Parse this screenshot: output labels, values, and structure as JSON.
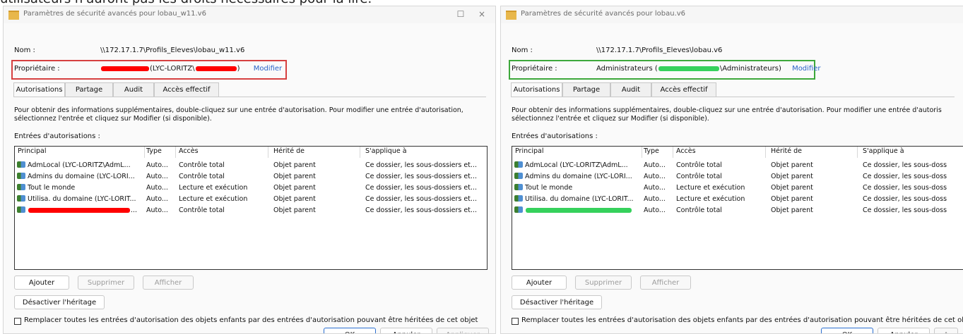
{
  "top_text": "utilisateurs n'auront pas les droits nécessaires pour la lire.",
  "windows": [
    {
      "side": "left",
      "title": "Paramètres de sécurité avancés pour lobau_w11.v6",
      "controls": {
        "maximize": "☐",
        "close": "×"
      },
      "name_label": "Nom :",
      "name_value": "\\\\172.17.1.7\\Profils_Eleves\\lobau_w11.v6",
      "owner_label": "Propriétaire :",
      "owner_value_parts": [
        "(LYC-LORITZ\\",
        ")"
      ],
      "owner_link": "Modifier",
      "tabs": [
        "Autorisations",
        "Partage",
        "Audit",
        "Accès effectif"
      ],
      "active_tab": 0,
      "info": "Pour obtenir des informations supplémentaires, double-cliquez sur une entrée d'autorisation. Pour modifier une entrée d'autorisation, sélectionnez l'entrée et cliquez sur Modifier (si disponible).",
      "entries_label": "Entrées d'autorisations :",
      "columns": [
        "Principal",
        "Type",
        "Accès",
        "Hérité de",
        "S'applique à"
      ],
      "rows": [
        [
          "AdmLocal (LYC-LORITZ\\AdmL...",
          "Auto...",
          "Contrôle total",
          "Objet parent",
          "Ce dossier, les sous-dossiers et..."
        ],
        [
          "Admins du domaine (LYC-LORI...",
          "Auto...",
          "Contrôle total",
          "Objet parent",
          "Ce dossier, les sous-dossiers et..."
        ],
        [
          "Tout le monde",
          "Auto...",
          "Lecture et exécution",
          "Objet parent",
          "Ce dossier, les sous-dossiers et..."
        ],
        [
          "Utilisa. du domaine (LYC-LORIT...",
          "Auto...",
          "Lecture et exécution",
          "Objet parent",
          "Ce dossier, les sous-dossiers et..."
        ],
        [
          "...",
          "Auto...",
          "Contrôle total",
          "Objet parent",
          "Ce dossier, les sous-dossiers et..."
        ]
      ],
      "buttons": {
        "add": "Ajouter",
        "remove": "Supprimer",
        "view": "Afficher",
        "disable_inheritance": "Désactiver l'héritage"
      },
      "checkbox_label": "Remplacer toutes les entrées d'autorisation des objets enfants par des entrées d'autorisation pouvant être héritées de cet objet",
      "footer": {
        "ok": "OK",
        "cancel": "Annuler",
        "apply": "Appliquer"
      },
      "colors": {
        "owner_box": "#d64040",
        "redaction": "#ff0000"
      }
    },
    {
      "side": "right",
      "title": "Paramètres de sécurité avancés pour lobau.v6",
      "name_label": "Nom :",
      "name_value": "\\\\172.17.1.7\\Profils_Eleves\\lobau.v6",
      "owner_label": "Propriétaire :",
      "owner_value_parts": [
        "Administrateurs (",
        "\\Administrateurs)"
      ],
      "owner_link": "Modifier",
      "tabs": [
        "Autorisations",
        "Partage",
        "Audit",
        "Accès effectif"
      ],
      "active_tab": 0,
      "info": "Pour obtenir des informations supplémentaires, double-cliquez sur une entrée d'autorisation. Pour modifier une entrée d'autoris sélectionnez l'entrée et cliquez sur Modifier (si disponible).",
      "entries_label": "Entrées d'autorisations :",
      "columns": [
        "Principal",
        "Type",
        "Accès",
        "Hérité de",
        "S'applique à"
      ],
      "rows": [
        [
          "AdmLocal (LYC-LORITZ\\AdmL...",
          "Auto...",
          "Contrôle total",
          "Objet parent",
          "Ce dossier, les sous-doss"
        ],
        [
          "Admins du domaine (LYC-LORI...",
          "Auto...",
          "Contrôle total",
          "Objet parent",
          "Ce dossier, les sous-doss"
        ],
        [
          "Tout le monde",
          "Auto...",
          "Lecture et exécution",
          "Objet parent",
          "Ce dossier, les sous-doss"
        ],
        [
          "Utilisa. du domaine (LYC-LORIT...",
          "Auto...",
          "Lecture et exécution",
          "Objet parent",
          "Ce dossier, les sous-doss"
        ],
        [
          "",
          "Auto...",
          "Contrôle total",
          "Objet parent",
          "Ce dossier, les sous-doss"
        ]
      ],
      "buttons": {
        "add": "Ajouter",
        "remove": "Supprimer",
        "view": "Afficher",
        "disable_inheritance": "Désactiver l'héritage"
      },
      "checkbox_label": "Remplacer toutes les entrées d'autorisation des objets enfants par des entrées d'autorisation pouvant être héritées de cet obje",
      "footer": {
        "ok": "OK",
        "cancel": "Annuler",
        "apply": "A"
      },
      "colors": {
        "owner_box": "#3da83b",
        "redaction": "#36d15c"
      }
    }
  ]
}
